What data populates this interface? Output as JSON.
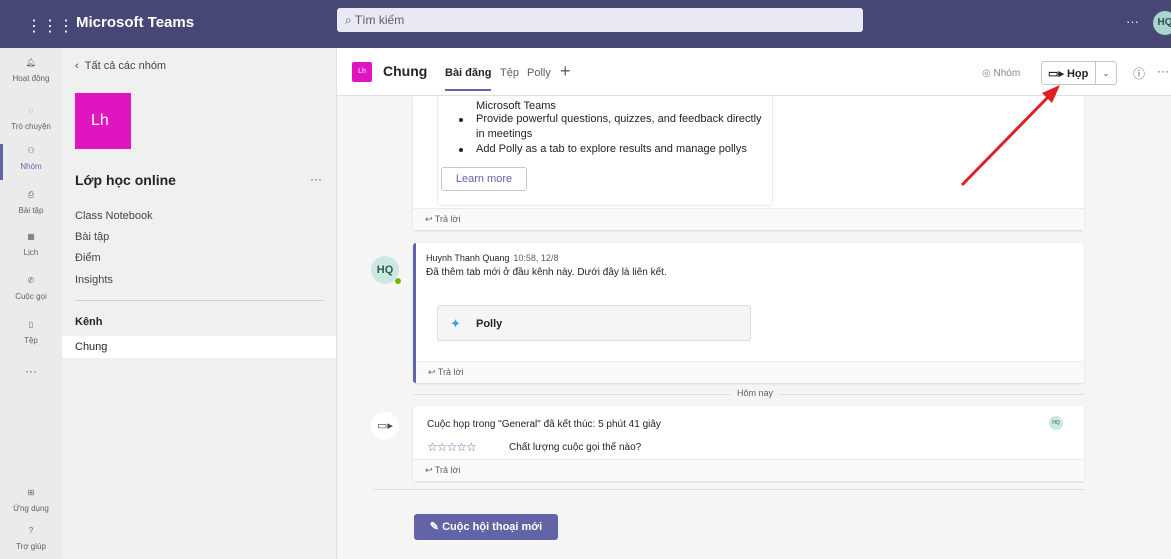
{
  "topbar": {
    "app_title": "Microsoft Teams",
    "search_placeholder": "Tìm kiếm",
    "more": "···",
    "avatar_initials": "HQ"
  },
  "rail": {
    "items": [
      {
        "icon": "bell-icon",
        "label": "Hoạt động"
      },
      {
        "icon": "chat-icon",
        "label": "Trò chuyện"
      },
      {
        "icon": "teams-icon",
        "label": "Nhóm"
      },
      {
        "icon": "assignments-icon",
        "label": "Bài tập"
      },
      {
        "icon": "calendar-icon",
        "label": "Lịch"
      },
      {
        "icon": "phone-icon",
        "label": "Cuộc gọi"
      },
      {
        "icon": "file-icon",
        "label": "Tệp"
      },
      {
        "icon": "more-icon",
        "label": "···"
      }
    ],
    "apps_label": "Ứng dụng",
    "help_label": "Trợ giúp"
  },
  "panel": {
    "back": "Tất cả các nhóm",
    "team_initials": "Lh",
    "team_name": "Lớp học online",
    "team_more": "···",
    "links": [
      "Class Notebook",
      "Bài tập",
      "Điểm",
      "Insights"
    ],
    "channels_title": "Kênh",
    "channel": "Chung"
  },
  "header": {
    "badge": "Lh",
    "channel_name": "Chung",
    "tabs": [
      "Bài đăng",
      "Tệp",
      "Polly"
    ],
    "add_tab": "+",
    "nhom": "Nhóm",
    "meet_label": "Họp",
    "more": "···"
  },
  "feed": {
    "card1": {
      "line0": "Microsoft Teams",
      "bullet1a": "Provide powerful questions, quizzes, and feedback directly",
      "bullet1b": "in meetings",
      "bullet2": "Add Polly as a tab to explore results and manage pollys",
      "learn_more": "Learn more",
      "reply": "Trả lời"
    },
    "card2": {
      "avatar": "HQ",
      "author": "Huynh Thanh Quang",
      "time": "10:58, 12/8",
      "message": "Đã thêm tab mới ở đầu kênh này. Dưới đây là liên kết.",
      "tab_name": "Polly",
      "reply": "Trả lời"
    },
    "date_separator": "Hôm nay",
    "card3": {
      "title": "Cuộc họp trong \"General\" đã kết thúc: 5 phút 41 giây",
      "stars": "☆☆☆☆☆",
      "rating_max": 5,
      "rating_value": 0,
      "quality_question": "Chất lượng cuộc gọi thế nào?",
      "mini_avatar": "HQ",
      "reply": "Trả lời"
    },
    "new_conversation": "Cuộc hội thoại mới"
  },
  "colors": {
    "topbar": "#464775",
    "accent": "#6264a7",
    "team_tile": "#e015c0",
    "annotation_arrow": "#e02020"
  }
}
